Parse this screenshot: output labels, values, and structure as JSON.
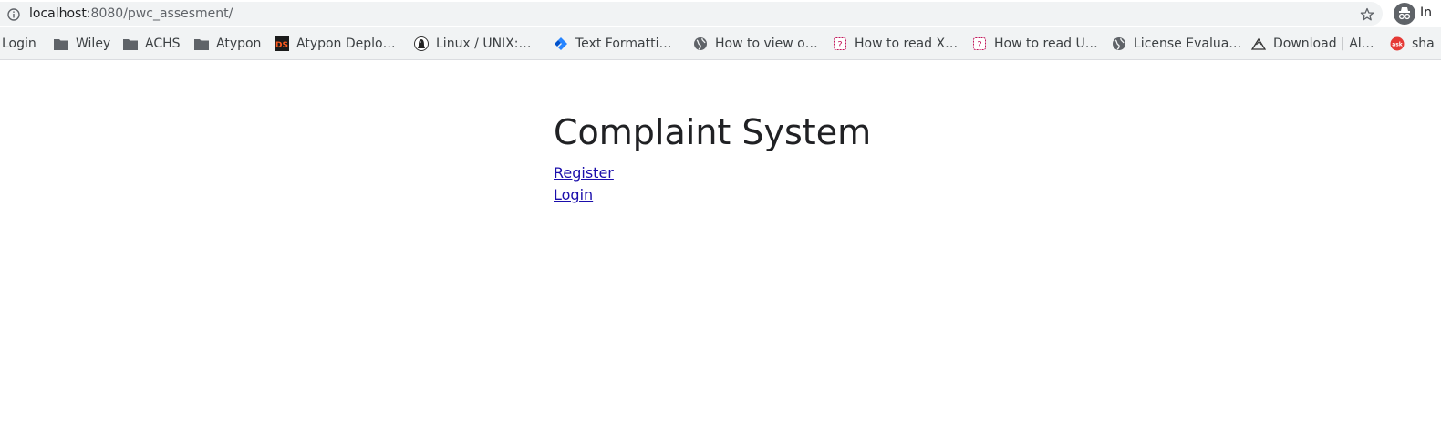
{
  "address_bar": {
    "url_host": "localhost",
    "url_rest": ":8080/pwc_assesment/",
    "incognito_label": "In"
  },
  "bookmarks": [
    {
      "label": "Login",
      "icon": "none"
    },
    {
      "label": "Wiley",
      "icon": "folder-icon"
    },
    {
      "label": "ACHS",
      "icon": "folder-icon"
    },
    {
      "label": "Atypon",
      "icon": "folder-icon"
    },
    {
      "label": "Atypon Deplo…",
      "icon": "ds-favicon"
    },
    {
      "label": "Linux / UNIX:…",
      "icon": "penguin-favicon"
    },
    {
      "label": "Text Formatti…",
      "icon": "jira-favicon"
    },
    {
      "label": "How to view o…",
      "icon": "globe-icon"
    },
    {
      "label": "How to read X…",
      "icon": "question-favicon"
    },
    {
      "label": "How to read U…",
      "icon": "question-favicon"
    },
    {
      "label": "License Evalua…",
      "icon": "globe-icon"
    },
    {
      "label": "Download | Al…",
      "icon": "mountain-favicon"
    },
    {
      "label": "sha",
      "icon": "ask-favicon"
    }
  ],
  "page": {
    "title": "Complaint System",
    "links": [
      "Register",
      "Login"
    ]
  },
  "colors": {
    "link": "#1a0dab",
    "heading": "#202124",
    "toolbar_bg": "#f1f3f4"
  }
}
